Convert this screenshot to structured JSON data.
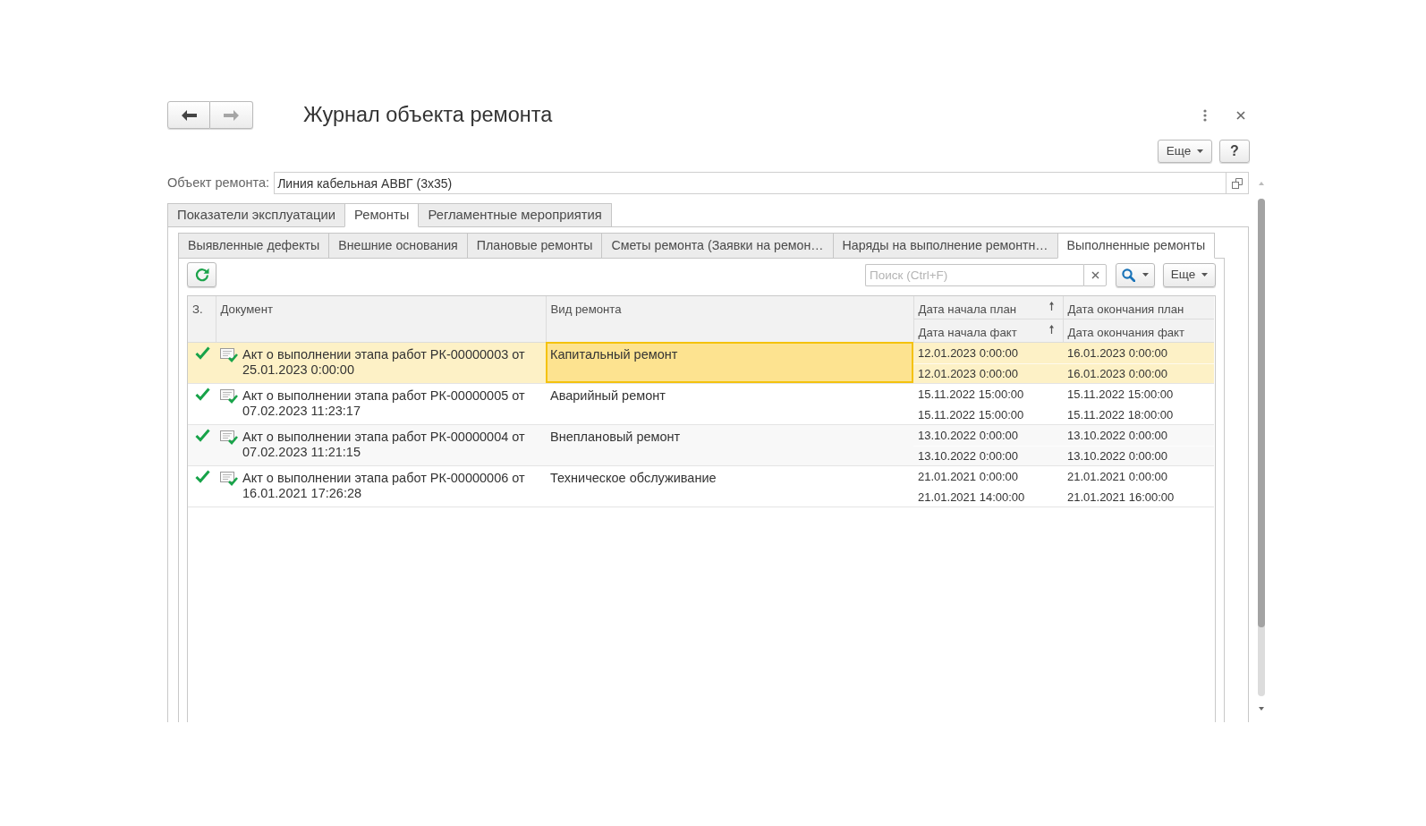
{
  "window": {
    "title": "Журнал объекта ремонта"
  },
  "navigation": [
    {
      "kind": "back",
      "disabled": false
    },
    {
      "kind": "forward",
      "disabled": true
    }
  ],
  "header_buttons": [
    {
      "kind": "more",
      "label": "Еще",
      "dropdown": true
    },
    {
      "kind": "help",
      "label": "?",
      "dropdown": false
    }
  ],
  "object_field": {
    "label": "Объект ремонта:",
    "value": "Линия кабельная АВВГ (3x35)"
  },
  "tabs": [
    {
      "label": "Показатели эксплуатации",
      "selected": false
    },
    {
      "label": "Ремонты",
      "selected": true
    },
    {
      "label": "Регламентные мероприятия",
      "selected": false
    }
  ],
  "subtabs": [
    {
      "label": "Выявленные дефекты",
      "selected": false
    },
    {
      "label": "Внешние основания",
      "selected": false
    },
    {
      "label": "Плановые ремонты",
      "selected": false
    },
    {
      "label": "Сметы ремонта (Заявки на ремон…",
      "selected": false
    },
    {
      "label": "Наряды на выполнение ремонтн…",
      "selected": false
    },
    {
      "label": "Выполненные ремонты",
      "selected": true
    }
  ],
  "toolbar": {
    "search": {
      "placeholder": "Поиск (Ctrl+F)"
    },
    "buttons": [
      {
        "kind": "refresh",
        "dropdown": false
      },
      {
        "kind": "search",
        "dropdown": true
      },
      {
        "kind": "more",
        "label": "Еще",
        "dropdown": true
      }
    ]
  },
  "table": {
    "columns": [
      {
        "headers": [
          {
            "text": "З.",
            "sorted": false
          }
        ]
      },
      {
        "headers": [
          {
            "text": "Документ",
            "sorted": false
          }
        ]
      },
      {
        "headers": [
          {
            "text": "Вид ремонта",
            "sorted": false
          }
        ]
      },
      {
        "headers": [
          {
            "text": "Дата начала план",
            "sorted": true
          },
          {
            "text": "Дата начала факт",
            "sorted": true
          }
        ]
      },
      {
        "headers": [
          {
            "text": "Дата окончания план",
            "sorted": false
          },
          {
            "text": "Дата окончания факт",
            "sorted": false
          }
        ]
      }
    ],
    "rows": [
      {
        "selected": true,
        "cells": [
          {
            "kind": "check",
            "checked": true,
            "focused": false
          },
          {
            "kind": "document",
            "text": "Акт о выполнении этапа работ РК-00000003 от 25.01.2023 0:00:00",
            "focused": false
          },
          {
            "kind": "text",
            "text": "Капитальный ремонт",
            "focused": true
          },
          {
            "kind": "dates",
            "lines": [
              "12.01.2023 0:00:00",
              "12.01.2023 0:00:00"
            ],
            "focused": false
          },
          {
            "kind": "dates",
            "lines": [
              "16.01.2023 0:00:00",
              "16.01.2023 0:00:00"
            ],
            "focused": false
          }
        ]
      },
      {
        "selected": false,
        "cells": [
          {
            "kind": "check",
            "checked": true,
            "focused": false
          },
          {
            "kind": "document",
            "text": "Акт о выполнении этапа работ РК-00000005 от 07.02.2023 11:23:17",
            "focused": false
          },
          {
            "kind": "text",
            "text": "Аварийный ремонт",
            "focused": false
          },
          {
            "kind": "dates",
            "lines": [
              "15.11.2022 15:00:00",
              "15.11.2022 15:00:00"
            ],
            "focused": false
          },
          {
            "kind": "dates",
            "lines": [
              "15.11.2022 15:00:00",
              "15.11.2022 18:00:00"
            ],
            "focused": false
          }
        ]
      },
      {
        "selected": false,
        "cells": [
          {
            "kind": "check",
            "checked": true,
            "focused": false
          },
          {
            "kind": "document",
            "text": "Акт о выполнении этапа работ РК-00000004 от 07.02.2023 11:21:15",
            "focused": false
          },
          {
            "kind": "text",
            "text": "Внеплановый ремонт",
            "focused": false
          },
          {
            "kind": "dates",
            "lines": [
              "13.10.2022 0:00:00",
              "13.10.2022 0:00:00"
            ],
            "focused": false
          },
          {
            "kind": "dates",
            "lines": [
              "13.10.2022 0:00:00",
              "13.10.2022 0:00:00"
            ],
            "focused": false
          }
        ]
      },
      {
        "selected": false,
        "cells": [
          {
            "kind": "check",
            "checked": true,
            "focused": false
          },
          {
            "kind": "document",
            "text": "Акт о выполнении этапа работ РК-00000006 от 16.01.2021 17:26:28",
            "focused": false
          },
          {
            "kind": "text",
            "text": "Техническое обслуживание",
            "focused": false
          },
          {
            "kind": "dates",
            "lines": [
              "21.01.2021 0:00:00",
              "21.01.2021 14:00:00"
            ],
            "focused": false
          },
          {
            "kind": "dates",
            "lines": [
              "21.01.2021 0:00:00",
              "21.01.2021 16:00:00"
            ],
            "focused": false
          }
        ]
      }
    ]
  }
}
